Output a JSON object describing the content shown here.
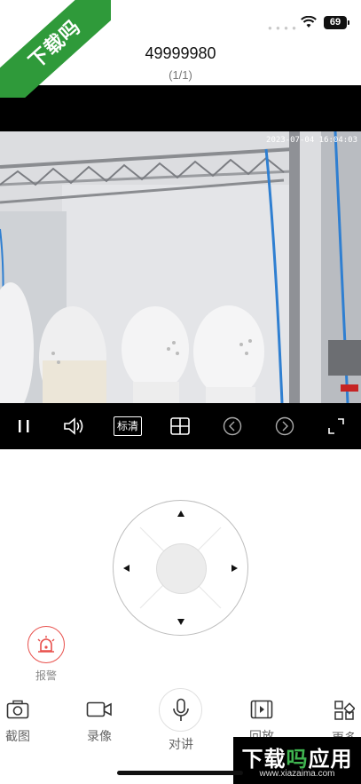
{
  "watermark_ribbon": "下载吗",
  "status": {
    "battery": "69"
  },
  "header": {
    "title": "49999980",
    "subtitle": "(1/1)"
  },
  "video": {
    "timestamp": "2023-07-04 16:04:03"
  },
  "controls": {
    "quality_label": "标清"
  },
  "alarm": {
    "label": "报警",
    "color": "#e8504c"
  },
  "toolbar": {
    "screenshot": "截图",
    "record": "录像",
    "talk": "对讲",
    "playback": "回放",
    "more": "更多"
  },
  "watermark": {
    "title_white": "下载",
    "title_green": "吗",
    "title_white2": "应用",
    "url": "www.xiazaima.com"
  }
}
